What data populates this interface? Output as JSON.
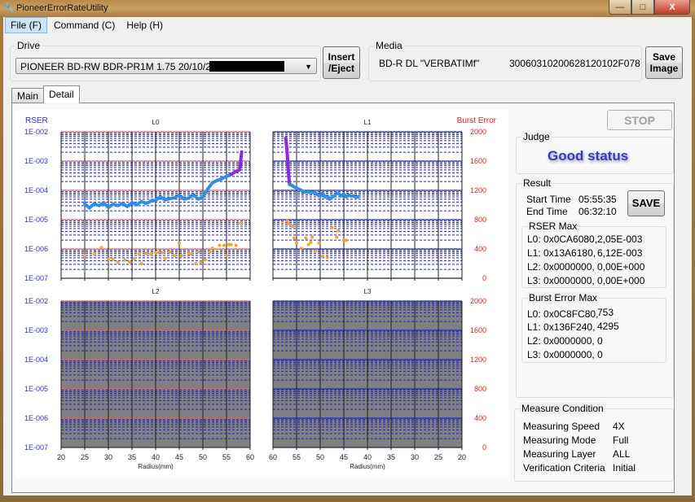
{
  "window": {
    "title": "PioneerErrorRateUtility",
    "controls": {
      "minimize": "—",
      "maximize": "□",
      "close": "X"
    }
  },
  "menu": [
    {
      "label": "File (F)",
      "active": true
    },
    {
      "label": "Command (C)"
    },
    {
      "label": "Help (H)"
    }
  ],
  "drive": {
    "group_label": "Drive",
    "selected": "PIONEER BD-RW BDR-PR1M  1.75 20/10/26"
  },
  "insert_eject_label_1": "Insert",
  "insert_eject_label_2": "/Eject",
  "media": {
    "group_label": "Media",
    "type": "BD-R DL \"VERBATIMf\"",
    "id": "30060310200628120102F078"
  },
  "save_image_label_1": "Save",
  "save_image_label_2": "Image",
  "tabs": [
    {
      "label": "Main",
      "active": false
    },
    {
      "label": "Detail",
      "active": true
    }
  ],
  "stop_label": "STOP",
  "judge": {
    "group_label": "Judge",
    "status": "Good status"
  },
  "result": {
    "group_label": "Result",
    "start_label": "Start Time",
    "start_value": "05:55:35",
    "end_label": "End Time",
    "end_value": "06:32:10",
    "save_label": "SAVE",
    "rser_max": {
      "label": "RSER Max",
      "rows": [
        {
          "layer": "L0: 0x0CA6080,",
          "value": "2,05E-003"
        },
        {
          "layer": "L1: 0x13A6180,",
          "value": "6,12E-003"
        },
        {
          "layer": "L2: 0x0000000,",
          "value": "0,00E+000"
        },
        {
          "layer": "L3: 0x0000000,",
          "value": "0,00E+000"
        }
      ]
    },
    "burst_max": {
      "label": "Burst Error Max",
      "rows": [
        {
          "layer": "L0: 0x0C8FC80,",
          "value": "753"
        },
        {
          "layer": "L1: 0x136F240,",
          "value": "4295"
        },
        {
          "layer": "L2: 0x0000000,",
          "value": "0"
        },
        {
          "layer": "L3: 0x0000000,",
          "value": "0"
        }
      ]
    }
  },
  "measure": {
    "group_label": "Measure Condition",
    "rows": [
      {
        "label": "Measuring Speed",
        "value": "4X"
      },
      {
        "label": "Measuring Mode",
        "value": "Full"
      },
      {
        "label": "Measuring Layer",
        "value": "ALL"
      },
      {
        "label": "Verification Criteria",
        "value": "Initial"
      }
    ]
  },
  "colors": {
    "rser_line": "#2f8ee8",
    "rser_over": "#8a2be2",
    "burst_dots": "#f5a623",
    "left_axis": "#3333cc",
    "right_axis": "#e02020",
    "empty_plot": "#808080"
  },
  "chart_data": [
    {
      "type": "line",
      "title": "L0",
      "xlabel": "",
      "ylabel": "RSER",
      "y2label": "Burst Error",
      "xlim": [
        20,
        60
      ],
      "ylim_log": [
        1e-07,
        0.01
      ],
      "y2lim": [
        0,
        2000
      ],
      "x_ticks": [
        20,
        25,
        30,
        35,
        40,
        45,
        50,
        55,
        60
      ],
      "y_tick_labels": [
        "1E-002",
        "1E-003",
        "1E-004",
        "1E-005",
        "1E-006",
        "1E-007"
      ],
      "y2_tick_labels": [
        "2000",
        "1600",
        "1200",
        "800",
        "400",
        "0"
      ],
      "series": [
        {
          "name": "RSER",
          "x": [
            25,
            26,
            27,
            28,
            29,
            30,
            31,
            32,
            33,
            34,
            35,
            36,
            37,
            38,
            39,
            40,
            41,
            42,
            43,
            44,
            45,
            46,
            47,
            48,
            49,
            50,
            51,
            52,
            53,
            54,
            55,
            56
          ],
          "values": [
            3.5e-05,
            2.5e-05,
            3.5e-05,
            3e-05,
            3.8e-05,
            2.6e-05,
            3.4e-05,
            3e-05,
            3.6e-05,
            2.8e-05,
            3.8e-05,
            3.2e-05,
            4.2e-05,
            3.6e-05,
            4.3e-05,
            4.6e-05,
            6e-05,
            4.8e-05,
            5.2e-05,
            5.6e-05,
            7e-05,
            5e-05,
            5.4e-05,
            7.2e-05,
            5e-05,
            6e-05,
            0.00011,
            0.00018,
            0.00022,
            0.00025,
            0.0003,
            0.00035
          ]
        },
        {
          "name": "RSER-high",
          "x": [
            56,
            57,
            57.8,
            58,
            58.2
          ],
          "values": [
            0.00035,
            0.00045,
            0.0005,
            0.001,
            0.00205
          ]
        },
        {
          "name": "Burst Error",
          "x": [
            25,
            27,
            28.5,
            30,
            31,
            32,
            33.5,
            34.5,
            35.5,
            36.5,
            37,
            38,
            39,
            40,
            40.5,
            41.5,
            42,
            43,
            44,
            45,
            45.5,
            47,
            47.5,
            48.5,
            49,
            49.5,
            50.5,
            51.5,
            52,
            53,
            53.5,
            54.5,
            55,
            55.5,
            56,
            57,
            58
          ],
          "values": [
            300,
            330,
            420,
            260,
            260,
            220,
            250,
            220,
            270,
            330,
            200,
            340,
            330,
            350,
            350,
            350,
            270,
            360,
            310,
            480,
            310,
            340,
            330,
            200,
            360,
            220,
            250,
            360,
            410,
            390,
            450,
            450,
            310,
            460,
            460,
            450,
            753
          ]
        }
      ]
    },
    {
      "type": "line",
      "title": "L1",
      "xlim": [
        60,
        20
      ],
      "ylim_log": [
        1e-07,
        0.01
      ],
      "y2lim": [
        0,
        2000
      ],
      "x_ticks": [
        60,
        55,
        50,
        45,
        40,
        35,
        30,
        25,
        20
      ],
      "series": [
        {
          "name": "RSER-high",
          "x": [
            57.3,
            57.0,
            56.8,
            56.5
          ],
          "values": [
            0.00612,
            0.002,
            0.0006,
            0.00016
          ]
        },
        {
          "name": "RSER",
          "x": [
            56.5,
            56,
            55.5,
            55,
            54.5,
            54,
            53.5,
            53,
            52.5,
            52,
            51.5,
            51,
            50.5,
            50,
            49.5,
            49,
            48.5,
            48,
            47.5,
            47,
            46.5,
            46,
            45.5,
            45,
            44.5,
            44,
            43.5,
            43,
            42.5,
            42
          ],
          "values": [
            0.00016,
            0.00015,
            0.00013,
            0.00012,
            0.00011,
            0.0001,
            9e-05,
            8.5e-05,
            8.8e-05,
            8.3e-05,
            8.5e-05,
            8.2e-05,
            7e-05,
            6.5e-05,
            8e-05,
            6e-05,
            6.5e-05,
            5e-05,
            5.8e-05,
            6.5e-05,
            8e-05,
            7.5e-05,
            6.5e-05,
            7.5e-05,
            6e-05,
            7e-05,
            6.5e-05,
            6.5e-05,
            6e-05,
            6e-05
          ]
        },
        {
          "name": "Burst Error",
          "x": [
            58,
            57,
            56.7,
            55.8,
            55.5,
            55,
            54,
            53,
            52.5,
            52,
            51.7,
            51,
            50.3,
            49.5,
            48.5,
            47.5,
            46.5,
            46.2,
            45,
            44.5
          ],
          "values": [
            760,
            780,
            740,
            710,
            550,
            480,
            410,
            550,
            460,
            490,
            560,
            370,
            480,
            300,
            280,
            690,
            560,
            650,
            520,
            520
          ]
        }
      ]
    },
    {
      "type": "line",
      "title": "L2",
      "xlabel": "Radius(mm)",
      "xlim": [
        20,
        60
      ],
      "ylim_log": [
        1e-07,
        0.01
      ],
      "y2lim": [
        0,
        2000
      ],
      "x_ticks": [
        20,
        25,
        30,
        35,
        40,
        45,
        50,
        55,
        60
      ],
      "series": []
    },
    {
      "type": "line",
      "title": "L3",
      "xlabel": "Radius(mm)",
      "xlim": [
        60,
        20
      ],
      "ylim_log": [
        1e-07,
        0.01
      ],
      "y2lim": [
        0,
        2000
      ],
      "x_ticks": [
        60,
        55,
        50,
        45,
        40,
        35,
        30,
        25,
        20
      ],
      "series": []
    }
  ]
}
